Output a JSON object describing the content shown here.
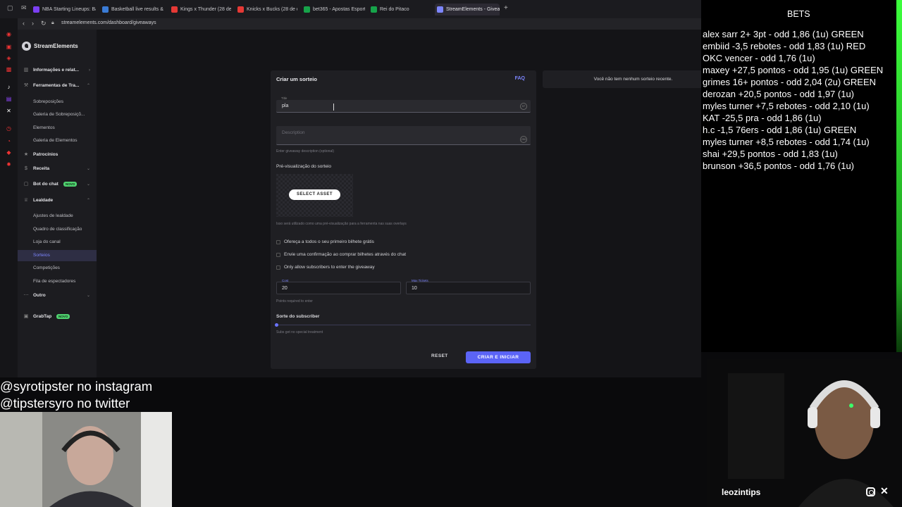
{
  "browser": {
    "tabs": [
      {
        "label": "NBA Starting Lineups: Ba",
        "color": "#7b3ff2"
      },
      {
        "label": "Basketball live results &",
        "color": "#3a7bd5"
      },
      {
        "label": "Kings x Thunder (28 de o",
        "color": "#e53935"
      },
      {
        "label": "Knicks x Bucks (28 de o",
        "color": "#e53935"
      },
      {
        "label": "bet365 - Apostas Esporti",
        "color": "#17a34a"
      },
      {
        "label": "Rei do Pitaco",
        "color": "#16a34a"
      },
      {
        "label": "StreamElements - Giveaw",
        "color": "#7d86ff"
      }
    ],
    "url": "streamelements.com/dashboard/giveaways"
  },
  "sidebar": {
    "brand": "StreamElements",
    "items": [
      {
        "label": "Informações e relat...",
        "type": "sec",
        "chev": "›"
      },
      {
        "label": "Ferramentas de Tra...",
        "type": "sec",
        "chev": "⌃"
      },
      {
        "label": "Sobreposições",
        "type": "sub"
      },
      {
        "label": "Galeria de Sobreposiçõ...",
        "type": "sub"
      },
      {
        "label": "Elementos",
        "type": "sub"
      },
      {
        "label": "Galeria de Elementos",
        "type": "sub"
      },
      {
        "label": "Patrocínios",
        "type": "sec2"
      },
      {
        "label": "Receita",
        "type": "sec",
        "chev": "⌄"
      },
      {
        "label": "Bot do chat",
        "type": "sec",
        "chev": "⌄",
        "pill": "NOVO"
      },
      {
        "label": "Lealdade",
        "type": "sec",
        "chev": "⌃"
      },
      {
        "label": "Ajustes de lealdade",
        "type": "sub"
      },
      {
        "label": "Quadro de classificação",
        "type": "sub"
      },
      {
        "label": "Loja do canal",
        "type": "sub"
      },
      {
        "label": "Sorteios",
        "type": "sub",
        "active": true
      },
      {
        "label": "Competições",
        "type": "sub"
      },
      {
        "label": "Fila de espectadores",
        "type": "sub"
      },
      {
        "label": "Outro",
        "type": "sec",
        "chev": "⌄"
      },
      {
        "label": "GrabTap",
        "type": "sec2",
        "pill": "NOVO"
      }
    ]
  },
  "giveaway": {
    "title": "Criar um sorteio",
    "faq": "FAQ",
    "title_field_label": "Title",
    "title_value": "pla",
    "title_counter": "97",
    "description_placeholder": "Description",
    "description_counter": "250",
    "description_hint": "Enter giveaway description (optional)",
    "preview_heading": "Pré-visualização do sorteio",
    "select_asset": "SELECT ASSET",
    "preview_hint": "Isso será utilizado como uma pré-visualização para a ferramenta nas suas overlays",
    "options": [
      "Ofereça a todos o seu primeiro bilhete grátis",
      "Envie uma confirmação ao comprar bilhetes através do chat",
      "Only allow subscribers to enter the giveaway"
    ],
    "cost_label": "Cost",
    "cost_value": "20",
    "max_tickets_label": "Max Tickets",
    "max_tickets_value": "10",
    "points_hint": "Points required to enter",
    "sub_luck_heading": "Sorte do subscriber",
    "sub_luck_hint": "Subs get no special treatment",
    "reset": "RESET",
    "create": "CRIAR E INICIAR",
    "recent_empty": "Você não tem nenhum sorteio recente."
  },
  "overlay": {
    "bets_title": "BETS",
    "bets": [
      "alex sarr 2+ 3pt - odd 1,86 (1u) GREEN",
      "embiid -3,5 rebotes - odd 1,83 (1u) RED",
      "OKC vencer - odd 1,76 (1u)",
      "maxey +27,5 pontos - odd 1,95 (1u) GREEN",
      "grimes 16+ pontos - odd 2,04 (2u) GREEN",
      "derozan +20,5 pontos - odd 1,97 (1u)",
      "myles turner +7,5 rebotes - odd 2,10 (1u)",
      "KAT -25,5 pra - odd 1,86 (1u)",
      "h.c -1,5 76ers - odd 1,86 (1u) GREEN",
      "myles turner +8,5 rebotes - odd 1,74 (1u)",
      "shai +29,5 pontos - odd 1,83 (1u)",
      "brunson +36,5 pontos - odd 1,76 (1u)"
    ],
    "social_instagram": "@syrotipster no instagram",
    "social_twitter": "@tipstersyro no twitter",
    "streamer_name": "leozintips"
  }
}
